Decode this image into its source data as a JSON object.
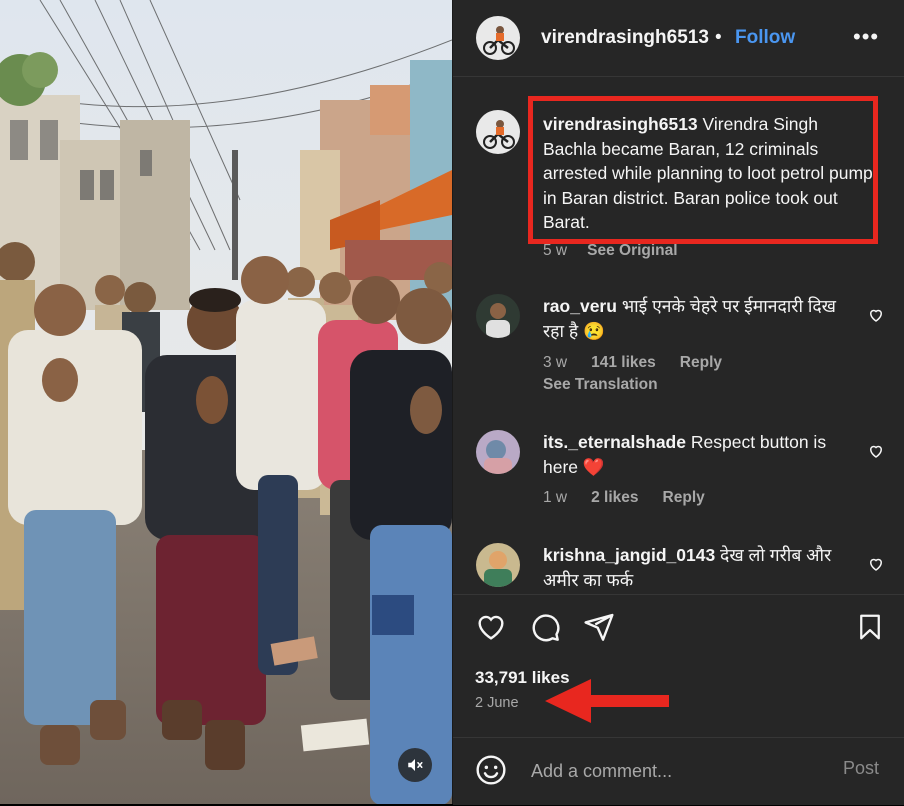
{
  "post": {
    "owner": "virendrasingh6513",
    "separator": "•",
    "follow_label": "Follow",
    "more_icon": "more-options-icon",
    "mute_icon": "speaker-muted-icon"
  },
  "caption": {
    "username": "virendrasingh6513",
    "text": "Virendra Singh Bachla became Baran, 12 criminals arrested while planning to loot petrol pump in Baran district. Baran police took out Barat.",
    "time": "5 w",
    "see_original": "See Original",
    "highlight_color": "#e8271f"
  },
  "comments": [
    {
      "username": "rao_veru",
      "text": "भाई एनके चेहरे पर ईमानदारी दिख रहा है",
      "emoji": "😢",
      "time": "3 w",
      "likes": "141 likes",
      "reply": "Reply",
      "see_translation": "See Translation"
    },
    {
      "username": "its._eternalshade",
      "text": "Respect button is here",
      "emoji": "❤️",
      "time": "1 w",
      "likes": "2 likes",
      "reply": "Reply"
    },
    {
      "username": "krishna_jangid_0143",
      "text": "देख लो गरीब और अमीर का फर्क"
    }
  ],
  "actions": {
    "like_icon": "heart-icon",
    "comment_icon": "comment-bubble-icon",
    "share_icon": "paper-plane-icon",
    "save_icon": "bookmark-icon",
    "likes_count": "33,791 likes",
    "date": "2 June",
    "arrow_color": "#e8271f"
  },
  "composer": {
    "emoji_icon": "smiley-icon",
    "placeholder": "Add a comment...",
    "post_label": "Post"
  },
  "colors": {
    "panel_bg": "#262626",
    "link_blue": "#4a96f0",
    "muted_text": "#a8a8a8"
  }
}
